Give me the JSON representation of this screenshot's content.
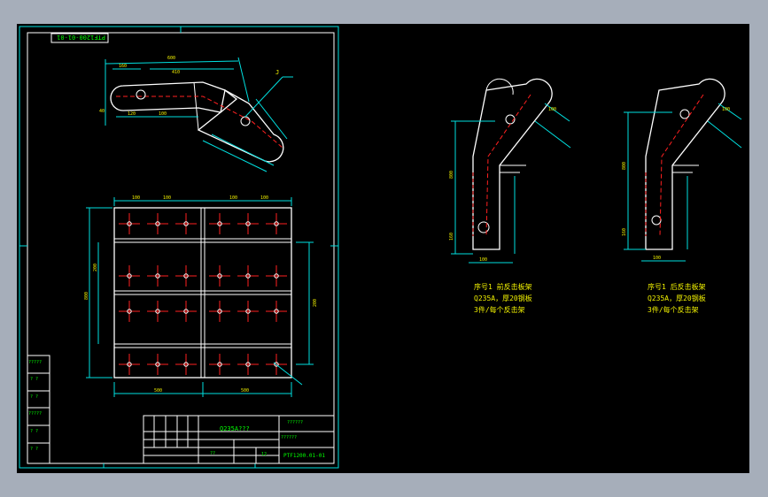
{
  "title_block": {
    "material": "Q235A???",
    "part_name": "??????",
    "drawing_label": "??????",
    "drawing_no": "PTF1200.01-01",
    "scale_mark": "12",
    "small_mark": "??"
  },
  "frame_tag": "PTF1200-01-01",
  "revision_column": [
    "?????",
    "? ?",
    "? ?",
    "?????",
    "? ?",
    "? ?"
  ],
  "top_view_dims": {
    "overall": "600",
    "left": "160",
    "mid": "410",
    "bottom_a": "120",
    "bottom_b": "100",
    "height": "40",
    "label": "J"
  },
  "plate_dims": {
    "top": [
      "100",
      "100",
      "100",
      "100"
    ],
    "bottom": [
      "500",
      "500"
    ],
    "left_outer": "800",
    "left_inner": "200",
    "right": "200"
  },
  "parts": [
    {
      "line1": "序号1 前反击板架",
      "line2": "Q235A，厚20钢板",
      "line3": "3件/每个反击架"
    },
    {
      "line1": "序号1 后反击板架",
      "line2": "Q235A，厚20钢板",
      "line3": "3件/每个反击架"
    }
  ],
  "side_dims": {
    "height": "800",
    "bottom": "100",
    "base_height": "160",
    "width": "100"
  },
  "colors": {
    "background": "#000000",
    "chrome": "#a6aeba",
    "frame": "#00e0e0",
    "outline": "#ffffff",
    "centerline": "#ff2020",
    "text": "#00ff00"
  }
}
